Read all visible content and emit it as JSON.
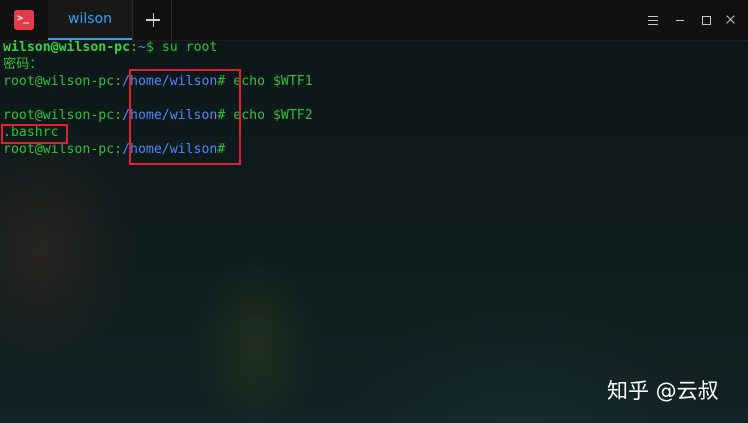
{
  "titlebar": {
    "app_icon_glyph": ">_",
    "tabs": [
      {
        "label": "wilson",
        "active": true
      }
    ],
    "new_tab_icon": "plus-icon",
    "window_controls": [
      "menu-icon",
      "minimize-icon",
      "maximize-icon",
      "close-icon"
    ]
  },
  "terminal": {
    "lines": [
      {
        "user": "wilson@wilson-pc",
        "sep": ":",
        "path": "~",
        "rest": "$ su root"
      },
      {
        "text": "密码："
      },
      {
        "prompt": "root@wilson-pc:",
        "path": "/home/wilson",
        "rest": "# echo $WTF1"
      },
      {
        "text": ""
      },
      {
        "prompt": "root@wilson-pc:",
        "path": "/home/wilson",
        "rest": "# echo $WTF2"
      },
      {
        "text": ".bashrc"
      },
      {
        "prompt": "root@wilson-pc:",
        "path": "/home/wilson",
        "rest": "#"
      }
    ]
  },
  "watermark": "知乎 @云叔",
  "colors": {
    "prompt_green": "#2fbf3a",
    "path_blue": "#4f86ff",
    "tab_accent": "#2ea3f2",
    "highlight_red": "#e0202e",
    "app_icon_red": "#e23c4c"
  }
}
